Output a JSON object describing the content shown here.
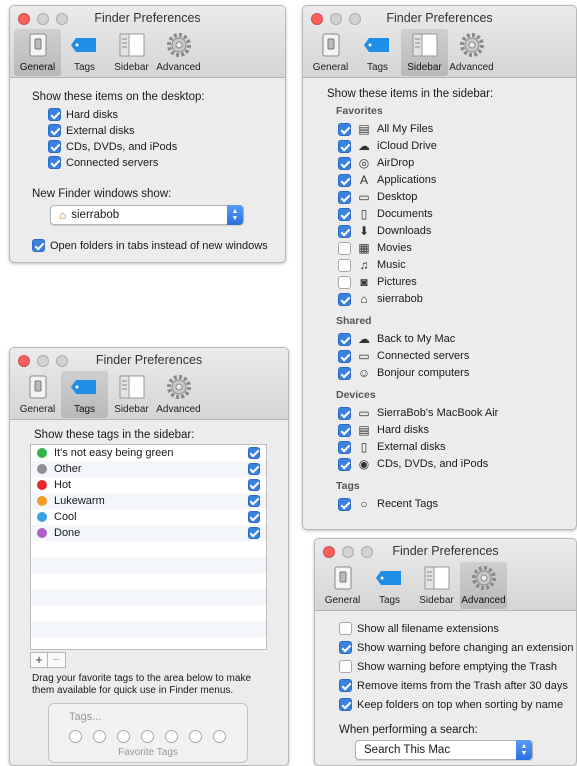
{
  "window_title": "Finder Preferences",
  "tabs": [
    "General",
    "Tags",
    "Sidebar",
    "Advanced"
  ],
  "general": {
    "desktop_heading": "Show these items on the desktop:",
    "desktop_items": [
      {
        "label": "Hard disks",
        "checked": true
      },
      {
        "label": "External disks",
        "checked": true
      },
      {
        "label": "CDs, DVDs, and iPods",
        "checked": true
      },
      {
        "label": "Connected servers",
        "checked": true
      }
    ],
    "new_window_label": "New Finder windows show:",
    "new_window_value": "sierrabob",
    "open_in_tabs": {
      "label": "Open folders in tabs instead of new windows",
      "checked": true
    }
  },
  "sidebar": {
    "heading": "Show these items in the sidebar:",
    "sections": [
      {
        "title": "Favorites",
        "items": [
          {
            "label": "All My Files",
            "icon": "all-files-icon",
            "checked": true
          },
          {
            "label": "iCloud Drive",
            "icon": "cloud-icon",
            "checked": true
          },
          {
            "label": "AirDrop",
            "icon": "airdrop-icon",
            "checked": true
          },
          {
            "label": "Applications",
            "icon": "applications-icon",
            "checked": true
          },
          {
            "label": "Desktop",
            "icon": "desktop-icon",
            "checked": true
          },
          {
            "label": "Documents",
            "icon": "documents-icon",
            "checked": true
          },
          {
            "label": "Downloads",
            "icon": "downloads-icon",
            "checked": true
          },
          {
            "label": "Movies",
            "icon": "movies-icon",
            "checked": false
          },
          {
            "label": "Music",
            "icon": "music-icon",
            "checked": false
          },
          {
            "label": "Pictures",
            "icon": "pictures-icon",
            "checked": false
          },
          {
            "label": "sierrabob",
            "icon": "home-icon",
            "checked": true
          }
        ]
      },
      {
        "title": "Shared",
        "items": [
          {
            "label": "Back to My Mac",
            "icon": "cloud-icon",
            "checked": true
          },
          {
            "label": "Connected servers",
            "icon": "display-icon",
            "checked": true
          },
          {
            "label": "Bonjour computers",
            "icon": "bonjour-icon",
            "checked": true
          }
        ]
      },
      {
        "title": "Devices",
        "items": [
          {
            "label": "SierraBob's MacBook Air",
            "icon": "laptop-icon",
            "checked": true
          },
          {
            "label": "Hard disks",
            "icon": "disk-icon",
            "checked": true
          },
          {
            "label": "External disks",
            "icon": "external-disk-icon",
            "checked": true
          },
          {
            "label": "CDs, DVDs, and iPods",
            "icon": "cd-icon",
            "checked": true
          }
        ]
      },
      {
        "title": "Tags",
        "items": [
          {
            "label": "Recent Tags",
            "icon": "tag-circle-icon",
            "checked": true
          }
        ]
      }
    ]
  },
  "tags": {
    "heading": "Show these tags in the sidebar:",
    "items": [
      {
        "label": "It's not easy being green",
        "color": "#2fb34a",
        "checked": true
      },
      {
        "label": "Other",
        "color": "#8e8e8e",
        "checked": true
      },
      {
        "label": "Hot",
        "color": "#e0282e",
        "checked": true
      },
      {
        "label": "Lukewarm",
        "color": "#f59a23",
        "checked": true
      },
      {
        "label": "Cool",
        "color": "#39a2e8",
        "checked": true
      },
      {
        "label": "Done",
        "color": "#b05fc7",
        "checked": true
      }
    ],
    "add_label": "+",
    "remove_label": "−",
    "hint": "Drag your favorite tags to the area below to make them available for quick use in Finder menus.",
    "favorites_placeholder": "Tags...",
    "favorites_caption": "Favorite Tags"
  },
  "advanced": {
    "options": [
      {
        "label": "Show all filename extensions",
        "checked": false
      },
      {
        "label": "Show warning before changing an extension",
        "checked": true
      },
      {
        "label": "Show warning before emptying the Trash",
        "checked": false
      },
      {
        "label": "Remove items from the Trash after 30 days",
        "checked": true
      },
      {
        "label": "Keep folders on top when sorting by name",
        "checked": true
      }
    ],
    "search_label": "When performing a search:",
    "search_value": "Search This Mac"
  }
}
